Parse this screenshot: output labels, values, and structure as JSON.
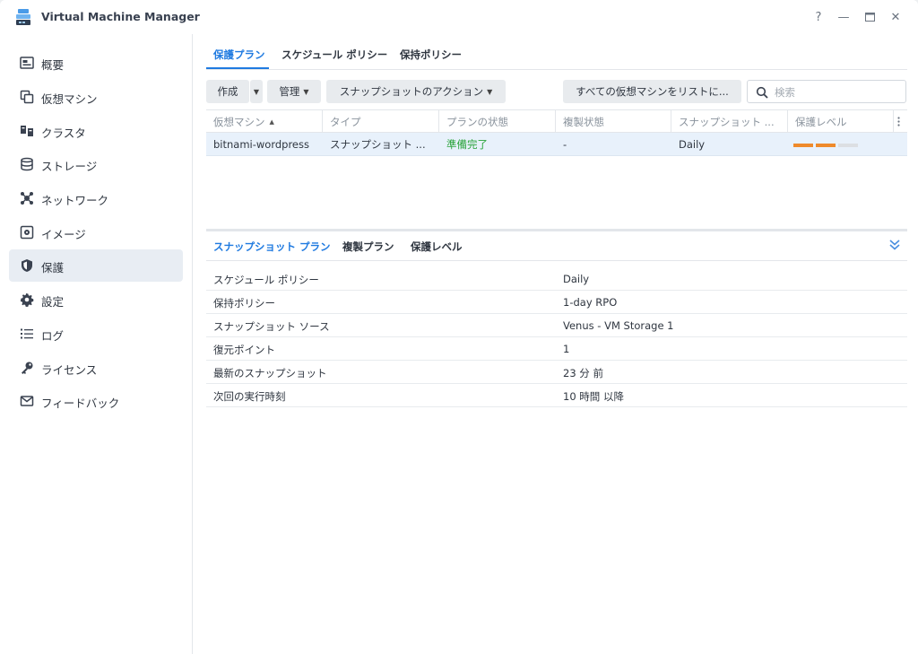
{
  "app": {
    "title": "Virtual Machine Manager",
    "accent": "#1f7ae0"
  },
  "window_controls": {
    "help": "?",
    "minimize": "—",
    "maximize": "▭",
    "close": "✕"
  },
  "sidebar": {
    "items": [
      {
        "label": "概要",
        "icon": "overview-icon"
      },
      {
        "label": "仮想マシン",
        "icon": "virtual-machine-icon"
      },
      {
        "label": "クラスタ",
        "icon": "cluster-icon"
      },
      {
        "label": "ストレージ",
        "icon": "storage-icon"
      },
      {
        "label": "ネットワーク",
        "icon": "network-icon"
      },
      {
        "label": "イメージ",
        "icon": "image-icon"
      },
      {
        "label": "保護",
        "icon": "shield-icon",
        "active": true
      },
      {
        "label": "設定",
        "icon": "gear-icon"
      },
      {
        "label": "ログ",
        "icon": "log-list-icon"
      },
      {
        "label": "ライセンス",
        "icon": "key-icon"
      },
      {
        "label": "フィードバック",
        "icon": "mail-icon"
      }
    ]
  },
  "tabs": {
    "protection_plan": "保護プラン",
    "schedule_policy": "スケジュール ポリシー",
    "retention_policy": "保持ポリシー"
  },
  "toolbar": {
    "create": "作成",
    "manage": "管理",
    "snapshot_actions": "スナップショットのアクション",
    "list_all_vms": "すべての仮想マシンをリストに...",
    "search_placeholder": "検索"
  },
  "table": {
    "columns": {
      "vm": "仮想マシン",
      "type": "タイプ",
      "plan_status": "プランの状態",
      "replication_status": "複製状態",
      "snapshot": "スナップショット ...",
      "protection_level": "保護レベル"
    },
    "rows": [
      {
        "vm": "bitnami-wordpress",
        "type": "スナップショット ...",
        "plan_status": "準備完了",
        "replication_status": "-",
        "snapshot": "Daily",
        "protection_level": "2 of 3",
        "level_colors": [
          "#ef8a2a",
          "#ef8a2a",
          "#dcdfe3"
        ]
      }
    ]
  },
  "detail": {
    "tabs": {
      "snapshot_plan": "スナップショット プラン",
      "replication_plan": "複製プラン",
      "protection_level": "保護レベル"
    },
    "props": [
      {
        "key": "スケジュール ポリシー",
        "value": "Daily"
      },
      {
        "key": "保持ポリシー",
        "value": "1-day RPO"
      },
      {
        "key": "スナップショット ソース",
        "value": "Venus - VM Storage 1"
      },
      {
        "key": "復元ポイント",
        "value": "1"
      },
      {
        "key": "最新のスナップショット",
        "value": "23 分 前"
      },
      {
        "key": "次回の実行時刻",
        "value": "10 時間 以降"
      }
    ]
  }
}
